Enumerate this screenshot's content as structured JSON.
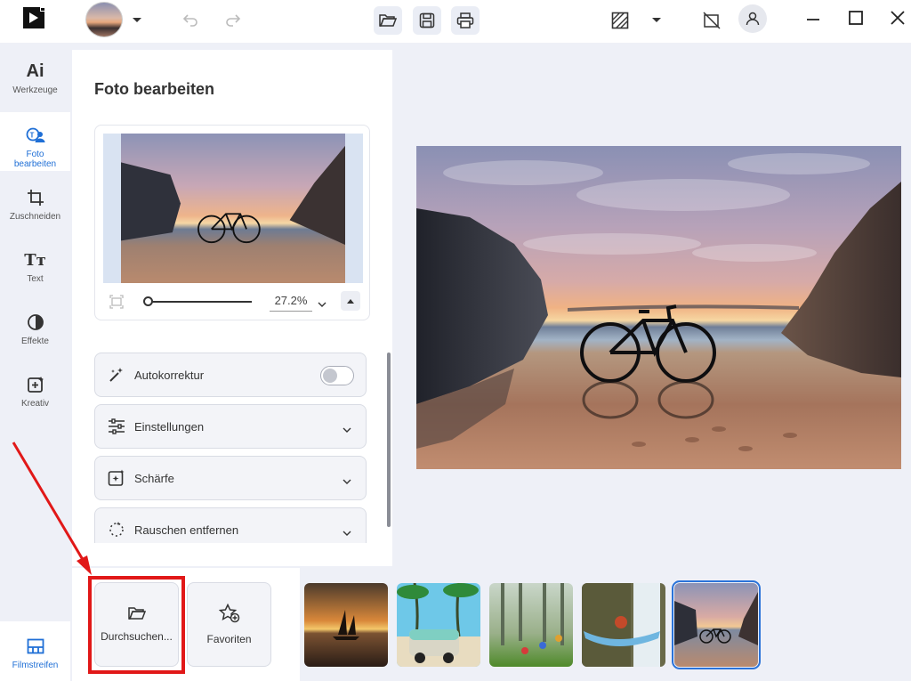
{
  "app": {
    "window_controls": [
      "minimize",
      "maximize",
      "close"
    ]
  },
  "sidebar": {
    "items": [
      {
        "label": "Werkzeuge",
        "icon": "ai-icon"
      },
      {
        "label": "Foto bearbeiten",
        "icon": "photo-edit-icon"
      },
      {
        "label": "Zuschneiden",
        "icon": "crop-icon"
      },
      {
        "label": "Text",
        "icon": "text-icon"
      },
      {
        "label": "Effekte",
        "icon": "effects-icon"
      },
      {
        "label": "Kreativ",
        "icon": "creative-icon"
      }
    ],
    "filmstrip_label": "Filmstreifen"
  },
  "panel": {
    "title": "Foto bearbeiten",
    "zoom": "27.2%",
    "sections": [
      {
        "label": "Autokorrektur",
        "type": "toggle",
        "on": false
      },
      {
        "label": "Einstellungen",
        "type": "expand"
      },
      {
        "label": "Schärfe",
        "type": "expand"
      },
      {
        "label": "Rauschen entfernen",
        "type": "expand"
      }
    ]
  },
  "filmstrip": {
    "browse_label": "Durchsuchen...",
    "favorites_label": "Favoriten",
    "thumbnails": [
      "sailboat-sunset",
      "van-palm-beach",
      "kids-foggy-forest",
      "waterfall-hammock",
      "bicycle-beach-sunset"
    ],
    "selected_index": 4
  },
  "colors": {
    "accent": "#1f6fd6",
    "highlight": "#e11818"
  }
}
